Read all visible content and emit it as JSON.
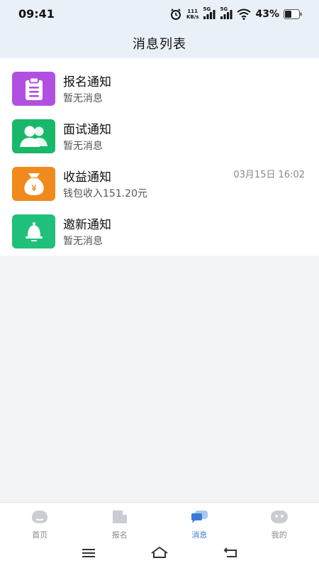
{
  "status_bar": {
    "time": "09:41",
    "net_speed_top": "111",
    "net_speed_bottom": "KB/s",
    "signal1_label": "5G",
    "signal2_label": "5G",
    "battery": "43%"
  },
  "header": {
    "title": "消息列表"
  },
  "messages": [
    {
      "title": "报名通知",
      "subtitle": "暂无消息",
      "time": "",
      "icon": "clipboard-icon",
      "color": "#b150e0"
    },
    {
      "title": "面试通知",
      "subtitle": "暂无消息",
      "time": "",
      "icon": "users-icon",
      "color": "#18b86a"
    },
    {
      "title": "收益通知",
      "subtitle": "钱包收入151.20元",
      "time": "03月15日 16:02",
      "icon": "money-bag-icon",
      "color": "#f08a1c"
    },
    {
      "title": "邀新通知",
      "subtitle": "暂无消息",
      "time": "",
      "icon": "bell-icon",
      "color": "#1fc07a"
    }
  ],
  "tabs": [
    {
      "label": "首页",
      "icon": "home-icon",
      "active": false
    },
    {
      "label": "报名",
      "icon": "document-icon",
      "active": false
    },
    {
      "label": "消息",
      "icon": "chat-icon",
      "active": true
    },
    {
      "label": "我的",
      "icon": "profile-icon",
      "active": false
    }
  ],
  "colors": {
    "accent": "#3a7bd5",
    "header_bg": "#eaf0f8",
    "page_bg": "#f3f4f6"
  }
}
